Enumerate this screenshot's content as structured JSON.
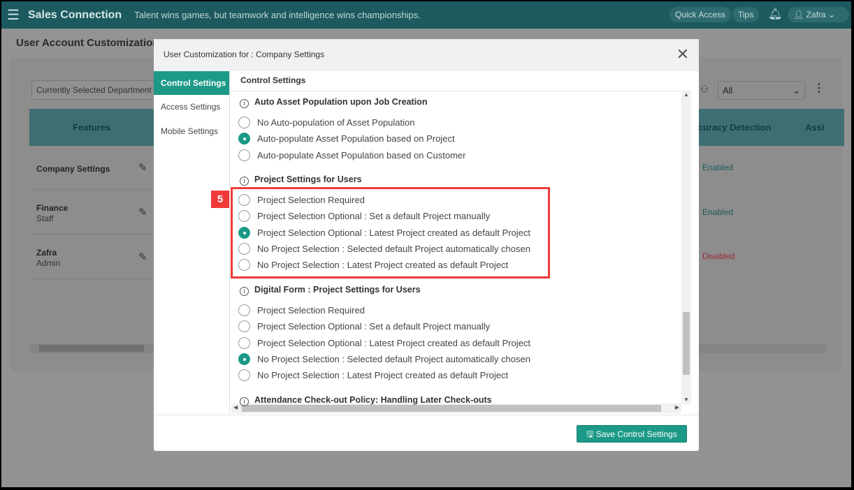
{
  "header": {
    "brand": "Sales Connection",
    "tagline": "Talent wins games, but teamwork and intelligence wins championships.",
    "quick_access": "Quick Access",
    "tips": "Tips",
    "user": "Zafra"
  },
  "page": {
    "title": "User Account Customization",
    "department_placeholder": "Currently Selected Department",
    "filter_value": "All",
    "columns": [
      "Features",
      "Accuracy Detection",
      "Assi"
    ],
    "rows": [
      {
        "name": "Company Settings",
        "sub": "",
        "status": "Enabled"
      },
      {
        "name": "Finance",
        "sub": "Staff",
        "status": "Enabled"
      },
      {
        "name": "Zafra",
        "sub": "Admin",
        "status": "Disabled"
      }
    ]
  },
  "modal": {
    "title": "User Customization for : Company Settings",
    "nav": [
      "Control Settings",
      "Access Settings",
      "Mobile Settings"
    ],
    "panel_title": "Control Settings",
    "save": "Save Control Settings",
    "sections": [
      {
        "title": "Auto Asset Population upon Job Creation",
        "options": [
          "No Auto-population of Asset Population",
          "Auto-populate Asset Population based on Project",
          "Auto-populate Asset Population based on Customer"
        ],
        "selected": 1
      },
      {
        "title": "Project Settings for Users",
        "options": [
          "Project Selection Required",
          "Project Selection Optional : Set a default Project manually",
          "Project Selection Optional : Latest Project created as default Project",
          "No Project Selection : Selected default Project automatically chosen",
          "No Project Selection : Latest Project created as default Project"
        ],
        "selected": 2
      },
      {
        "title": "Digital Form : Project Settings for Users",
        "options": [
          "Project Selection Required",
          "Project Selection Optional : Set a default Project manually",
          "Project Selection Optional : Latest Project created as default Project",
          "No Project Selection : Selected default Project automatically chosen",
          "No Project Selection : Latest Project created as default Project"
        ],
        "selected": 3
      },
      {
        "title": "Attendance Check-out Policy: Handling Later Check-outs",
        "options": [],
        "selected": -1
      }
    ]
  },
  "annotation": {
    "step": "5"
  },
  "colors": {
    "accent": "#1c9a87",
    "header": "#1c5a5f",
    "highlight": "#f03a3a"
  }
}
